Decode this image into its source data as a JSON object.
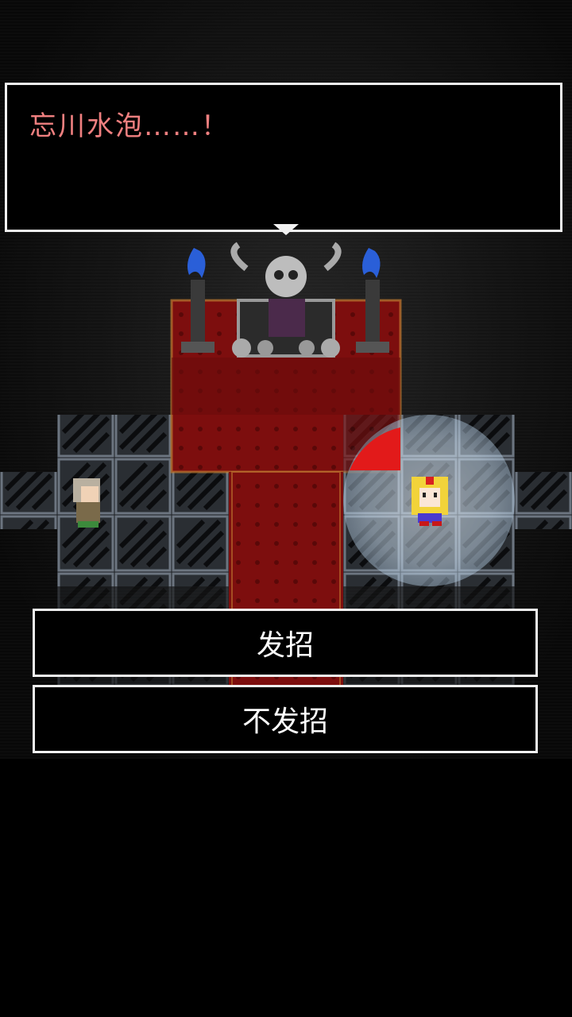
{
  "dialog": {
    "text": "忘川水泡……！"
  },
  "choices": [
    {
      "label": "发招"
    },
    {
      "label": "不发招"
    }
  ],
  "colors": {
    "dialog_text": "#f08080",
    "carpet": "#8b1010",
    "tile": "#3a3f45",
    "highlight": "#d9ecff",
    "flame": "#2a5fd8"
  },
  "icons": {
    "throne": "skull-throne-icon",
    "torch_left": "blue-flame-torch-icon",
    "torch_right": "blue-flame-torch-icon",
    "npc_left": "elder-character-icon",
    "npc_right": "blonde-heroine-icon"
  }
}
